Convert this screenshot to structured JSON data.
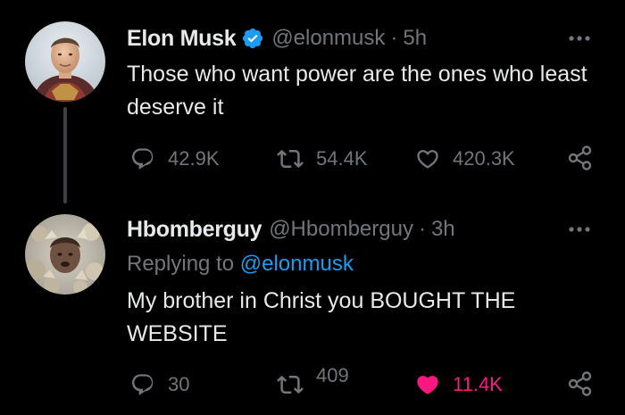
{
  "colors": {
    "background": "#000000",
    "text_primary": "#e7e9ea",
    "text_secondary": "#71767b",
    "accent": "#1d9bf0",
    "like": "#f91880",
    "verified": "#1d9bf0"
  },
  "tweets": [
    {
      "name": "Elon Musk",
      "verified": true,
      "handle": "@elonmusk",
      "separator": "·",
      "time": "5h",
      "text": "Those who want power are the ones who least deserve it",
      "actions": {
        "reply": {
          "icon": "reply-icon",
          "count": "42.9K"
        },
        "retweet": {
          "icon": "retweet-icon",
          "count": "54.4K"
        },
        "like": {
          "icon": "heart-outline-icon",
          "count": "420.3K"
        },
        "share": {
          "icon": "share-icon"
        }
      }
    },
    {
      "name": "Hbomberguy",
      "verified": false,
      "handle": "@Hbomberguy",
      "separator": "·",
      "time": "3h",
      "replying_to_label": "Replying to",
      "replying_to_handle": "@elonmusk",
      "text": "My brother in Christ you BOUGHT THE WEBSITE",
      "actions": {
        "reply": {
          "icon": "reply-icon",
          "count": "30"
        },
        "retweet": {
          "icon": "retweet-icon",
          "count": "409"
        },
        "like": {
          "icon": "heart-filled-icon",
          "count": "11.4K",
          "liked": true
        },
        "share": {
          "icon": "share-icon"
        }
      }
    }
  ]
}
